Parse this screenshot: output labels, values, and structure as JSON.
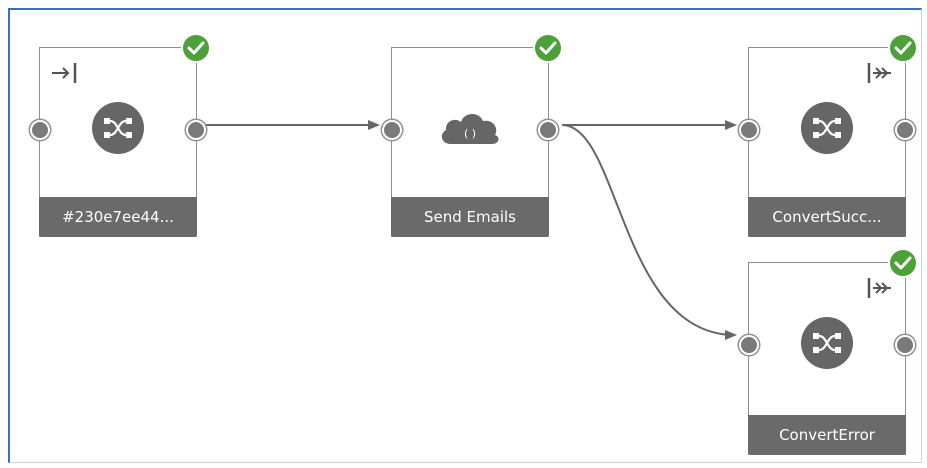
{
  "canvas": {
    "colors": {
      "frame": "#3a6fc9",
      "node_border": "#8f8f8f",
      "footer": "#6a6a6a",
      "icon": "#666666",
      "check": "#4ea13a",
      "link": "#666666"
    }
  },
  "nodes": [
    {
      "id": "n1",
      "label": "#230e7ee44...",
      "icon": "shuffle-icon",
      "corner_icon": "start-arrow-icon",
      "status": "success"
    },
    {
      "id": "n2",
      "label": "Send Emails",
      "icon": "cloud-code-icon",
      "corner_icon": "",
      "status": "success"
    },
    {
      "id": "n3",
      "label": "ConvertSucc...",
      "icon": "shuffle-icon",
      "corner_icon": "end-arrow-icon",
      "status": "success"
    },
    {
      "id": "n4",
      "label": "ConvertError",
      "icon": "shuffle-icon",
      "corner_icon": "end-arrow-icon",
      "status": "success"
    }
  ],
  "links": [
    {
      "from": "n1",
      "to": "n2"
    },
    {
      "from": "n2",
      "to": "n3"
    },
    {
      "from": "n2",
      "to": "n4"
    }
  ]
}
